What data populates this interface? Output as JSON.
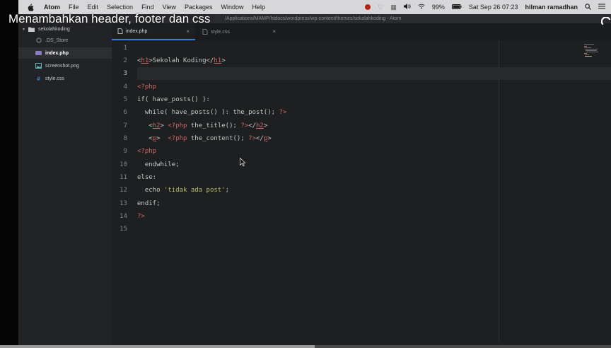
{
  "video": {
    "title": "Menambahkan header, footer dan css",
    "buffered_fraction": 0.515
  },
  "menubar": {
    "items": [
      "Atom",
      "File",
      "Edit",
      "Selection",
      "Find",
      "View",
      "Packages",
      "Window",
      "Help"
    ],
    "battery": "99%",
    "datetime": "Sat Sep 26  07:23",
    "user": "hilman ramadhan"
  },
  "window": {
    "path": "/Applications/MAMP/htdocs/wordpress/wp-content/themes/sekolahkoding - Atom"
  },
  "tree": {
    "root": "sekolahkoding",
    "files": [
      {
        "name": ".DS_Store",
        "icon": "dot-file-icon",
        "color": "#8a8d91"
      },
      {
        "name": "index.php",
        "icon": "php-file-icon",
        "color": "#8e7cc3",
        "active": true
      },
      {
        "name": "screenshot.png",
        "icon": "image-file-icon",
        "color": "#5fb3b3"
      },
      {
        "name": "style.css",
        "icon": "css-file-icon",
        "color": "#4a8fd8"
      }
    ]
  },
  "tabs": [
    {
      "label": "index.php",
      "active": true,
      "close": "×"
    },
    {
      "label": "style.css",
      "active": false,
      "close": "×"
    }
  ],
  "editor": {
    "current_line": 3,
    "line_numbers": [
      "1",
      "2",
      "3",
      "4",
      "5",
      "6",
      "7",
      "8",
      "9",
      "10",
      "11",
      "12",
      "13",
      "14",
      "15"
    ]
  },
  "colors": {
    "accent": "#3b7bd4",
    "tag": "#cc6666",
    "string": "#b5bd68",
    "text": "#c5c8c6"
  }
}
